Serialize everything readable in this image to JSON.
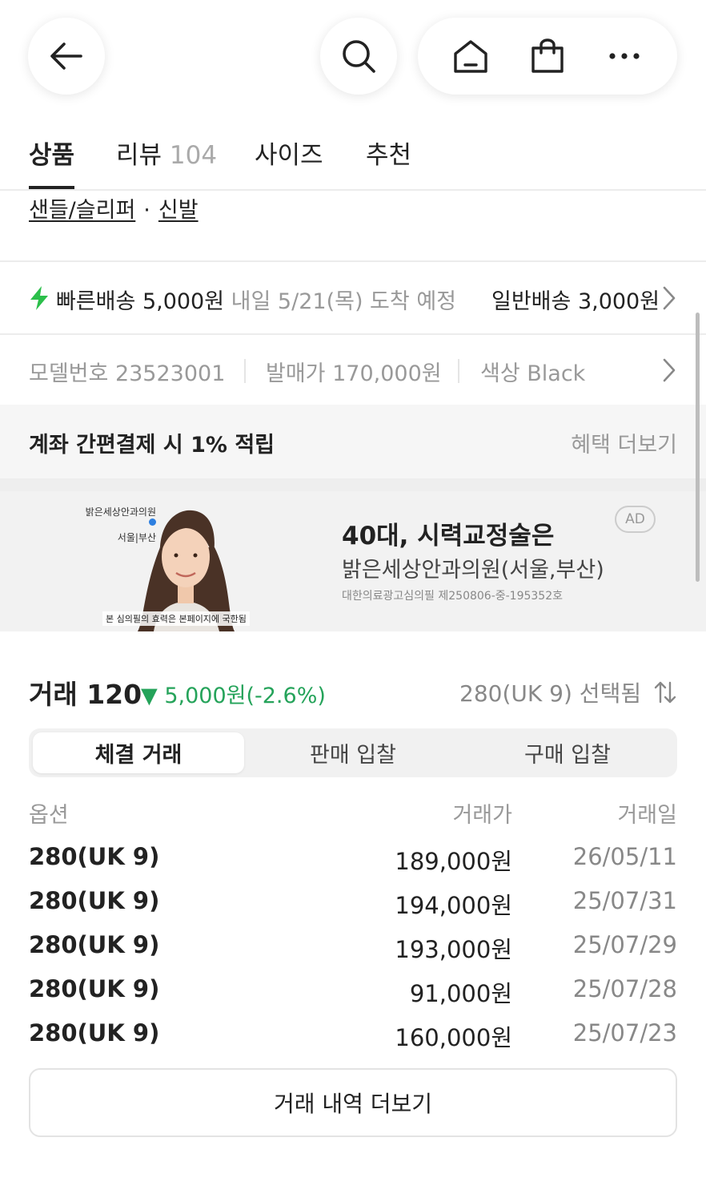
{
  "nav": {
    "back_icon": "arrow-left-icon",
    "search_icon": "search-icon",
    "home_icon": "home-icon",
    "bag_icon": "shopping-bag-icon",
    "more_icon": "more-horizontal-icon"
  },
  "tabs": [
    {
      "label": "상품",
      "count": "",
      "active": true
    },
    {
      "label": "리뷰",
      "count": "104",
      "active": false
    },
    {
      "label": "사이즈",
      "count": "",
      "active": false
    },
    {
      "label": "추천",
      "count": "",
      "active": false
    }
  ],
  "breadcrumb": {
    "category": "샌들/슬리퍼",
    "separator": "·",
    "subcategory": "신발"
  },
  "shipping": {
    "fast_label": "빠른배송 5,000원",
    "fast_eta": "내일 5/21(목) 도착 예정",
    "normal_label": "일반배송 3,000원",
    "accent": "#2bbf4a"
  },
  "product_info": {
    "model": "모델번호 23523001",
    "release_price": "발매가 170,000원",
    "color": "색상 Black"
  },
  "benefit": {
    "title": "계좌 간편결제 시 1% 적립",
    "more": "혜택 더보기"
  },
  "ad": {
    "logo_line1": "밝은세상안과의원",
    "logo_line2": "서울|부산",
    "disclaimer": "본 심의필의 효력은 본페이지에 국한됨",
    "headline": "40대, 시력교정술은",
    "subtitle": "밝은세상안과의원(서울,부산)",
    "approval": "대한의료광고심의필 제250806-중-195352호",
    "badge": "AD"
  },
  "trade": {
    "label": "거래 120",
    "change": "▼ 5,000원(-2.6%)",
    "change_color": "#25a35a",
    "selected": "280(UK 9) 선택됨",
    "sort_icon": "sort-arrows-icon"
  },
  "segments": [
    {
      "label": "체결 거래",
      "active": true
    },
    {
      "label": "판매 입찰",
      "active": false
    },
    {
      "label": "구매 입찰",
      "active": false
    }
  ],
  "table": {
    "headers": {
      "option": "옵션",
      "price": "거래가",
      "date": "거래일"
    },
    "rows": [
      {
        "option": "280(UK 9)",
        "price": "189,000원",
        "date": "26/05/11"
      },
      {
        "option": "280(UK 9)",
        "price": "194,000원",
        "date": "25/07/31"
      },
      {
        "option": "280(UK 9)",
        "price": "193,000원",
        "date": "25/07/29"
      },
      {
        "option": "280(UK 9)",
        "price": "91,000원",
        "date": "25/07/28"
      },
      {
        "option": "280(UK 9)",
        "price": "160,000원",
        "date": "25/07/23"
      }
    ]
  },
  "more_button": "거래 내역 더보기"
}
